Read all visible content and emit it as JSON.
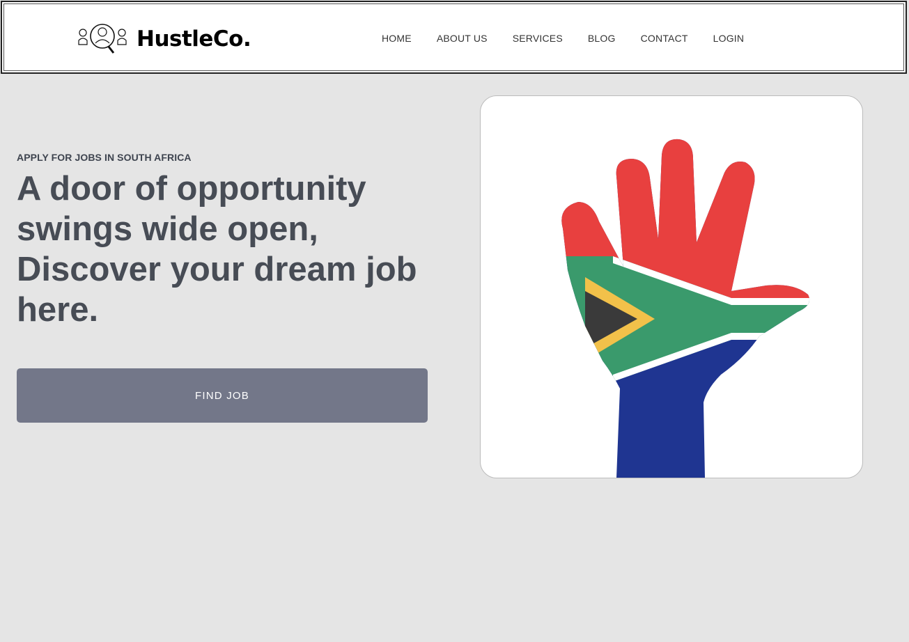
{
  "brand": {
    "name": "HustleCo.",
    "logo_icon": "people-search-icon"
  },
  "nav": {
    "items": [
      "HOME",
      "ABOUT US",
      "SERVICES",
      "BLOG",
      "CONTACT",
      "LOGIN"
    ]
  },
  "hero": {
    "eyebrow": "APPLY FOR JOBS IN SOUTH AFRICA",
    "headline": "A door of opportunity swings wide open, Discover your dream job here.",
    "cta_label": "FIND JOB",
    "image": "south-africa-flag-painted-hand-image"
  },
  "colors": {
    "page_bg": "#e5e5e5",
    "headline": "#474c55",
    "button_bg": "#737789",
    "flag_red": "#e8403f",
    "flag_green": "#3a9a6c",
    "flag_blue": "#1f3591",
    "flag_yellow": "#f2c14a"
  }
}
